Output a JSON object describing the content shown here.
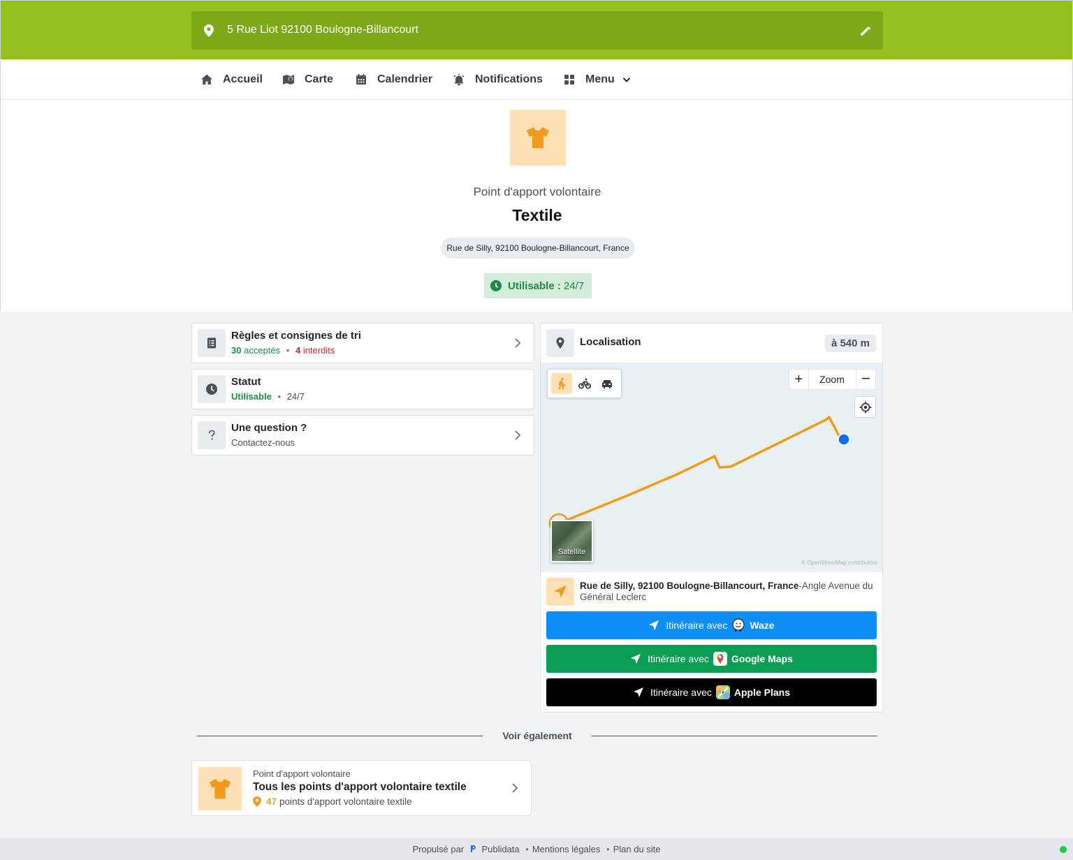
{
  "header": {
    "address": "5 Rue Liot 92100 Boulogne-Billancourt"
  },
  "nav": {
    "items": [
      {
        "label": "Accueil"
      },
      {
        "label": "Carte"
      },
      {
        "label": "Calendrier"
      },
      {
        "label": "Notifications"
      },
      {
        "label": "Menu"
      }
    ]
  },
  "hero": {
    "subtitle": "Point d'apport volontaire",
    "title": "Textile",
    "address": "Rue de Silly, 92100 Boulogne-Billancourt, France",
    "status_label": "Utilisable :",
    "status_value": "24/7"
  },
  "cards": {
    "rules": {
      "title": "Règles et consignes de tri",
      "accepted_count": "30",
      "accepted_label": "acceptés",
      "forbidden_count": "4",
      "forbidden_label": "interdits"
    },
    "status": {
      "title": "Statut",
      "state": "Utilisable",
      "hours": "24/7"
    },
    "question": {
      "title": "Une question ?",
      "subtitle": "Contactez-nous"
    }
  },
  "location": {
    "title": "Localisation",
    "distance": "à 540 m",
    "zoom_label": "Zoom",
    "satellite_label": "Satellite",
    "attribution": "© OpenStreetMap contributors",
    "address_bold": "Rue de Silly, 92100 Boulogne-Billancourt, France",
    "address_rest": "-Angle Avenue du Général Leclerc",
    "buttons": [
      {
        "prefix": "Itinéraire avec",
        "app": "Waze",
        "color": "#0d8ff5"
      },
      {
        "prefix": "Itinéraire avec",
        "app": "Google Maps",
        "color": "#0a9e55"
      },
      {
        "prefix": "Itinéraire avec",
        "app": "Apple Plans",
        "color": "#000000"
      }
    ],
    "route_color": "#f29a1a"
  },
  "see_also": {
    "label": "Voir également",
    "item": {
      "category": "Point d'apport volontaire",
      "title": "Tous les points d'apport volontaire textile",
      "count": "47",
      "count_label": "points d'apport volontaire textile"
    }
  },
  "footer": {
    "powered_by": "Propulsé par",
    "brand": "Publidata",
    "legal": "Mentions légales",
    "sitemap": "Plan du site"
  },
  "colors": {
    "brand_green": "#93c01f",
    "accent_orange": "#f29a1a",
    "status_green": "#1e8a45",
    "forbidden_red": "#c0282f"
  }
}
